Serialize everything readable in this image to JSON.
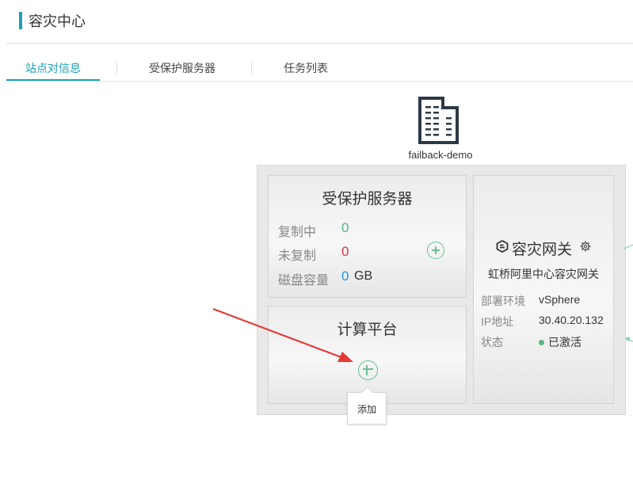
{
  "page": {
    "title": "容灾中心"
  },
  "tabs": [
    {
      "label": "站点对信息",
      "active": true
    },
    {
      "label": "受保护服务器",
      "active": false
    },
    {
      "label": "任务列表",
      "active": false
    }
  ],
  "site": {
    "name": "failback-demo",
    "icon": "building-icon"
  },
  "protected_servers": {
    "title": "受保护服务器",
    "replicating": {
      "label": "复制中",
      "value": "0"
    },
    "not_replicated": {
      "label": "未复制",
      "value": "0"
    },
    "disk_capacity": {
      "label": "磁盘容量",
      "value": "0",
      "unit": "GB"
    },
    "add_icon": "plus-circle-icon"
  },
  "compute_platform": {
    "title": "计算平台",
    "add_icon": "plus-circle-icon"
  },
  "tooltip": {
    "text": "添加"
  },
  "gateway": {
    "title": "容灾网关",
    "name": "虹桥阿里中心容灾网关",
    "icons": [
      "gateway-icon",
      "gear-icon"
    ],
    "deploy_env": {
      "label": "部署环境",
      "value": "vSphere"
    },
    "ip": {
      "label": "IP地址",
      "value": "30.40.20.132"
    },
    "status": {
      "label": "状态",
      "value": "已激活"
    }
  },
  "colors": {
    "accent": "#1aa1b9",
    "green": "#5bb287",
    "red": "#e8323c",
    "blue": "#2196e6",
    "arrow": "#e53935"
  }
}
